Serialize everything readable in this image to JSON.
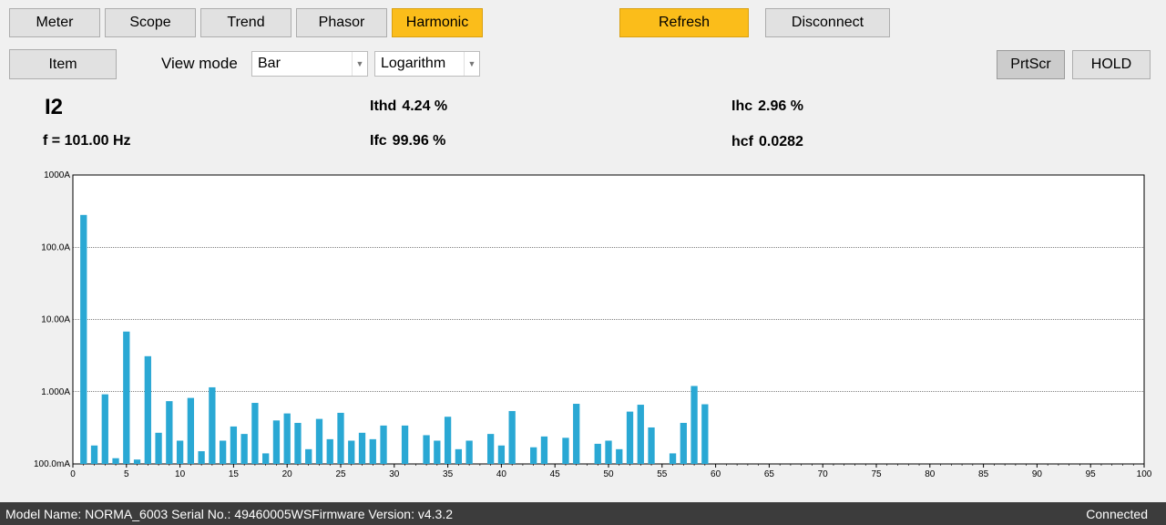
{
  "tabs": [
    {
      "label": "Meter",
      "active": false
    },
    {
      "label": "Scope",
      "active": false
    },
    {
      "label": "Trend",
      "active": false
    },
    {
      "label": "Phasor",
      "active": false
    },
    {
      "label": "Harmonic",
      "active": true
    }
  ],
  "toolbar": {
    "refresh_label": "Refresh",
    "disconnect_label": "Disconnect",
    "item_label": "Item",
    "view_mode_label": "View mode",
    "view_mode_value": "Bar",
    "scale_value": "Logarithm",
    "prtscr_label": "PrtScr",
    "hold_label": "HOLD"
  },
  "info": {
    "channel": "I2",
    "freq_text": "f = 101.00 Hz",
    "ithd_label": "Ithd",
    "ithd_value": "4.24 %",
    "ifc_label": "Ifc",
    "ifc_value": "99.96 %",
    "ihc_label": "Ihc",
    "ihc_value": "2.96 %",
    "hcf_label": "hcf",
    "hcf_value": "0.0282"
  },
  "colors": {
    "accent": "#fbbd1a",
    "bar": "#2aa8d4",
    "status_bg": "#3c3c3c"
  },
  "chart_data": {
    "type": "bar",
    "yscale": "log",
    "ylim": [
      0.1,
      1000
    ],
    "xlim": [
      0,
      100
    ],
    "y_tick_labels": [
      "1000A",
      "100.0A",
      "10.00A",
      "1.000A",
      "100.0mA"
    ],
    "y_tick_values": [
      1000,
      100,
      10,
      1,
      0.1
    ],
    "x_tick_labels": [
      "0",
      "5",
      "10",
      "15",
      "20",
      "25",
      "30",
      "35",
      "40",
      "45",
      "50",
      "55",
      "60",
      "65",
      "70",
      "75",
      "80",
      "85",
      "90",
      "95",
      "100"
    ],
    "x_tick_values": [
      0,
      5,
      10,
      15,
      20,
      25,
      30,
      35,
      40,
      45,
      50,
      55,
      60,
      65,
      70,
      75,
      80,
      85,
      90,
      95,
      100
    ],
    "harmonics": [
      1,
      2,
      3,
      4,
      5,
      6,
      7,
      8,
      9,
      10,
      11,
      12,
      13,
      14,
      15,
      16,
      17,
      18,
      19,
      20,
      21,
      22,
      23,
      24,
      25,
      26,
      27,
      28,
      29,
      30,
      31,
      32,
      33,
      34,
      35,
      36,
      37,
      38,
      39,
      40,
      41,
      42,
      43,
      44,
      45,
      46,
      47,
      48,
      49,
      50,
      51,
      52,
      53,
      54,
      55,
      56,
      57,
      58,
      59
    ],
    "values": [
      280,
      0.18,
      0.92,
      0.12,
      6.8,
      0.115,
      3.1,
      0.27,
      0.74,
      0.21,
      0.82,
      0.15,
      1.15,
      0.21,
      0.33,
      0.26,
      0.7,
      0.14,
      0.4,
      0.5,
      0.37,
      0.16,
      0.42,
      0.22,
      0.51,
      0.21,
      0.27,
      0.22,
      0.34,
      null,
      0.34,
      null,
      0.25,
      0.21,
      0.45,
      0.16,
      0.21,
      null,
      0.26,
      0.18,
      0.54,
      null,
      0.17,
      0.24,
      null,
      0.23,
      0.68,
      null,
      0.19,
      0.21,
      0.16,
      0.53,
      0.66,
      0.32,
      null,
      0.14,
      0.37,
      1.2,
      0.67
    ]
  },
  "status_bar": {
    "left_text": "Model Name:  NORMA_6003 Serial No.:  49460005WSFirmware Version:  v4.3.2",
    "right_text": "Connected"
  }
}
